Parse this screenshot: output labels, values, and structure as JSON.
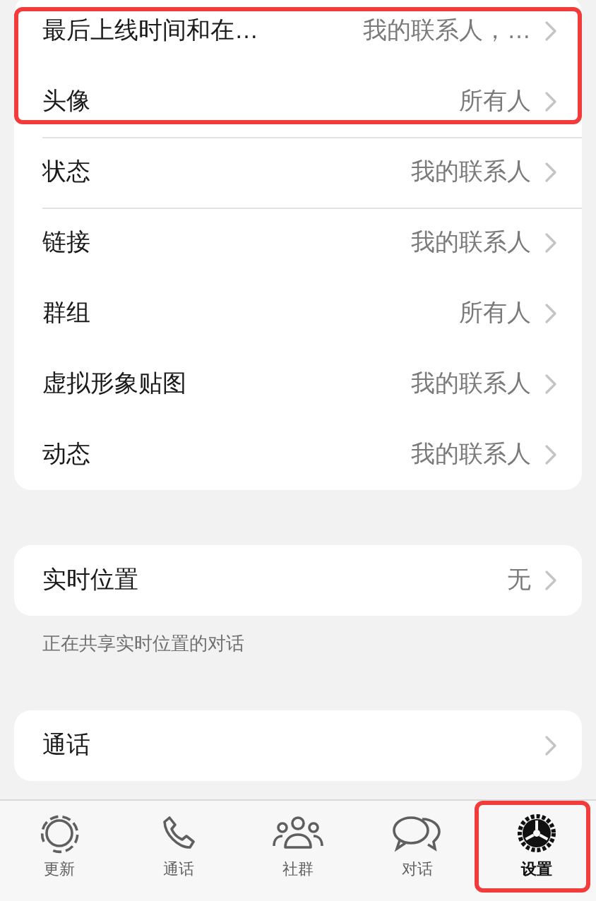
{
  "sections": [
    {
      "rows": [
        {
          "label": "最后上线时间和在…",
          "value": "我的联系人，…",
          "highlighted": true,
          "divider": false
        },
        {
          "label": "头像",
          "value": "所有人",
          "highlighted": true,
          "divider": false
        },
        {
          "label": "状态",
          "value": "我的联系人",
          "highlighted": false,
          "divider": true
        },
        {
          "label": "链接",
          "value": "我的联系人",
          "highlighted": false,
          "divider": true
        },
        {
          "label": "群组",
          "value": "所有人",
          "highlighted": false,
          "divider": false
        },
        {
          "label": "虚拟形象贴图",
          "value": "我的联系人",
          "highlighted": false,
          "divider": false
        },
        {
          "label": "动态",
          "value": "我的联系人",
          "highlighted": false,
          "divider": false
        }
      ]
    },
    {
      "rows": [
        {
          "label": "实时位置",
          "value": "无",
          "highlighted": false,
          "divider": false
        }
      ],
      "caption": "正在共享实时位置的对话"
    },
    {
      "rows": [
        {
          "label": "通话",
          "highlighted": false,
          "divider": false
        }
      ]
    }
  ],
  "tab_bar": [
    {
      "kind": "updates",
      "label": "更新",
      "selected": false,
      "highlighted": false
    },
    {
      "kind": "calls",
      "label": "通话",
      "selected": false,
      "highlighted": false
    },
    {
      "kind": "communities",
      "label": "社群",
      "selected": false,
      "highlighted": false
    },
    {
      "kind": "chats",
      "label": "对话",
      "selected": false,
      "highlighted": false
    },
    {
      "kind": "settings",
      "label": "设置",
      "selected": true,
      "highlighted": true
    }
  ]
}
